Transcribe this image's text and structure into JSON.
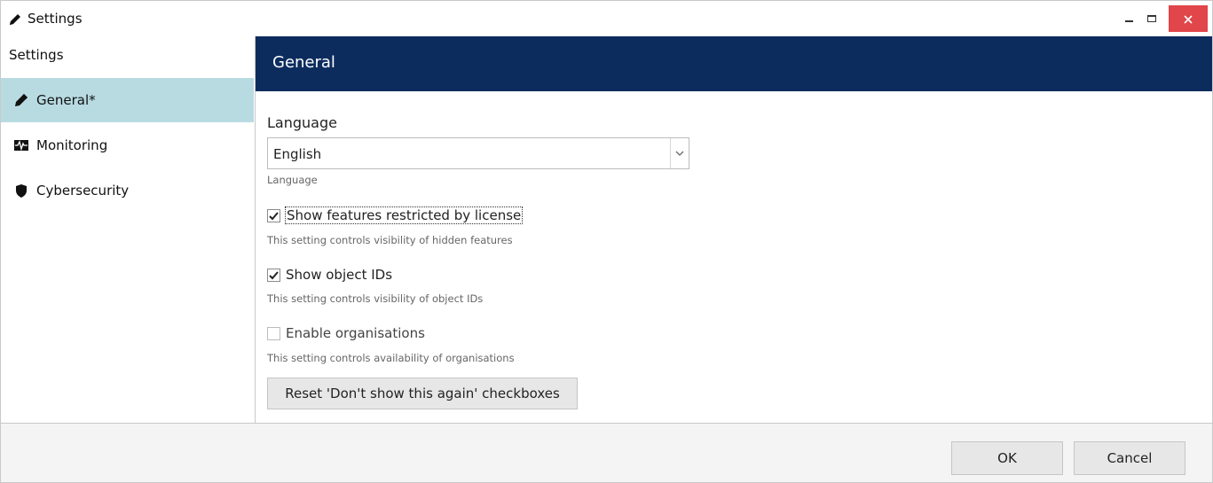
{
  "window": {
    "title": "Settings",
    "title_icon": "pencil-icon",
    "controls": {
      "minimize": "minimize-icon",
      "maximize": "maximize-icon",
      "close": "close-icon"
    },
    "close_color": "#e0464a"
  },
  "sidebar": {
    "header": "Settings",
    "items": [
      {
        "label": "General*",
        "icon": "pencil-icon",
        "active": true
      },
      {
        "label": "Monitoring",
        "icon": "monitoring-icon",
        "active": false
      },
      {
        "label": "Cybersecurity",
        "icon": "shield-icon",
        "active": false
      }
    ],
    "active_color": "#b8dbe2"
  },
  "content": {
    "heading": "General",
    "header_color": "#0d2c5e",
    "language": {
      "label": "Language",
      "value": "English",
      "hint": "Language"
    },
    "checkboxes": [
      {
        "label": "Show features restricted by license",
        "checked": true,
        "enabled": true,
        "hint": "This setting controls visibility of hidden features"
      },
      {
        "label": "Show object IDs",
        "checked": true,
        "enabled": true,
        "hint": "This setting controls visibility of object IDs"
      },
      {
        "label": "Enable organisations",
        "checked": false,
        "enabled": false,
        "hint": "This setting controls availability of organisations"
      }
    ],
    "reset_button": "Reset 'Don't show this again' checkboxes"
  },
  "footer": {
    "ok_label": "OK",
    "cancel_label": "Cancel"
  }
}
